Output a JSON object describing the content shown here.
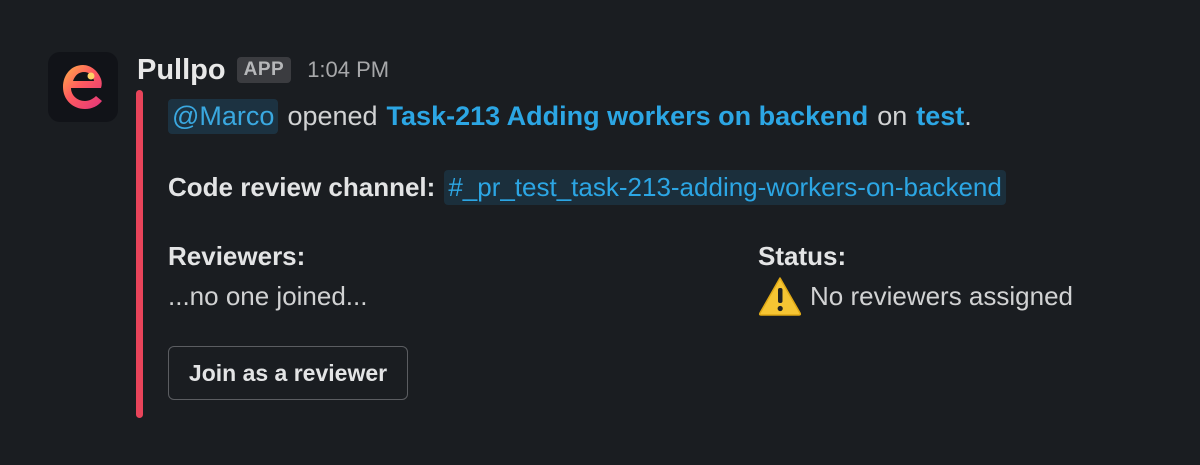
{
  "message": {
    "app_name": "Pullpo",
    "badge": "APP",
    "timestamp": "1:04 PM",
    "avatar_icon": "pullpo-logo-icon",
    "accent_color": "#e8445a",
    "line1": {
      "mention": "@Marco",
      "verb": "opened",
      "task_link": "Task-213 Adding workers on backend",
      "on": "on",
      "repo_link": "test",
      "period": "."
    },
    "code_review": {
      "label": "Code review channel:",
      "channel": "#_pr_test_task-213-adding-workers-on-backend"
    },
    "reviewers": {
      "label": "Reviewers:",
      "value": "...no one joined..."
    },
    "status": {
      "label": "Status:",
      "icon": "warning-icon",
      "value": "No reviewers assigned"
    },
    "join_button": "Join as a reviewer"
  }
}
